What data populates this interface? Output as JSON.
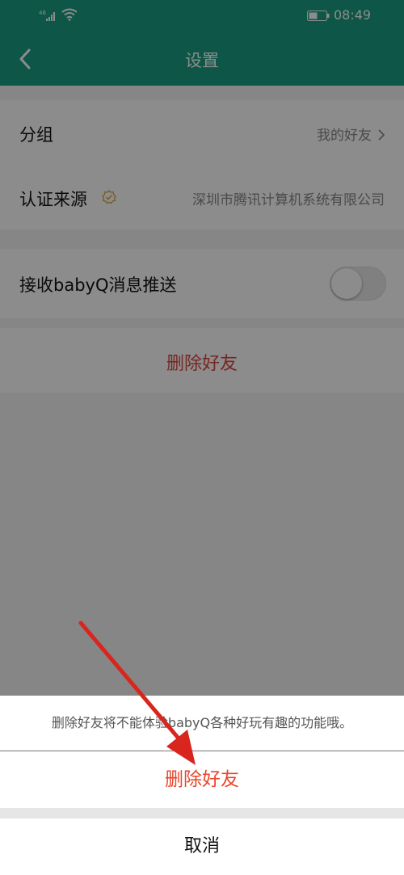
{
  "status_bar": {
    "signal_text": "46",
    "time": "08:49"
  },
  "app_bar": {
    "title": "设置"
  },
  "settings": {
    "group_label": "分组",
    "group_value": "我的好友",
    "verify_label": "认证来源",
    "verify_value": "深圳市腾讯计算机系统有限公司",
    "push_label": "接收babyQ消息推送",
    "push_enabled": false,
    "delete_label": "删除好友"
  },
  "action_sheet": {
    "message": "删除好友将不能体验babyQ各种好玩有趣的功能哦。",
    "delete_button": "删除好友",
    "cancel_button": "取消"
  },
  "colors": {
    "header": "#1b9d82",
    "delete_red": "#e8462c",
    "annotation_arrow": "#d8261f"
  }
}
